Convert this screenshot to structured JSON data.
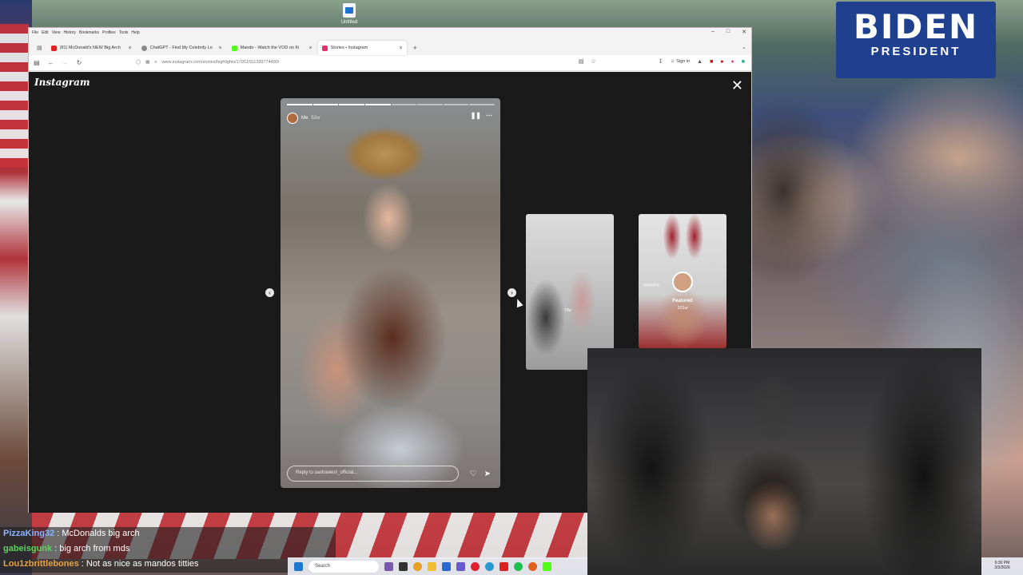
{
  "desktop": {
    "icon_label": "Untitled"
  },
  "sign": {
    "line1": "BIDEN",
    "line2": "PRESIDENT"
  },
  "browser": {
    "menu": [
      "File",
      "Edit",
      "View",
      "History",
      "Bookmarks",
      "Profiles",
      "Tools",
      "Help"
    ],
    "tabs": [
      {
        "label": "(81) McDonald's NEW Big Arch",
        "color": "#e02020"
      },
      {
        "label": "ChatGPT - Find My Celebrity Lo",
        "color": "#888888"
      },
      {
        "label": "Mando - Watch the VOD on Ki",
        "color": "#53fc18"
      },
      {
        "label": "Stories • Instagram",
        "color": "#e1306c"
      }
    ],
    "url": "www.instagram.com/stories/highlights/17951551399774490/",
    "signin_label": "Sign in"
  },
  "instagram": {
    "logo": "Instagram",
    "story": {
      "username": "Me",
      "age": "52w",
      "reply_placeholder": "Reply to sashawest_official...",
      "progress_total": 8,
      "progress_done": 4
    },
    "thumb_gym": {
      "age": "73w"
    },
    "thumb_bunny": {
      "tag": "@playboy",
      "title": "Featured",
      "age": "101w"
    }
  },
  "chat": [
    {
      "user": "PizzaKing32",
      "color": "#8ab4ff",
      "msg": "McDonalds big arch"
    },
    {
      "user": "gabeisgunk",
      "color": "#5dd35d",
      "msg": "big arch from mds"
    },
    {
      "user": "Lou1zbrittlebones",
      "color": "#e6a23c",
      "msg": "Not as nice as mandos titties"
    }
  ],
  "taskbar": {
    "search_label": "Search",
    "time": "6:30 PM",
    "date": "3/3/2026"
  }
}
